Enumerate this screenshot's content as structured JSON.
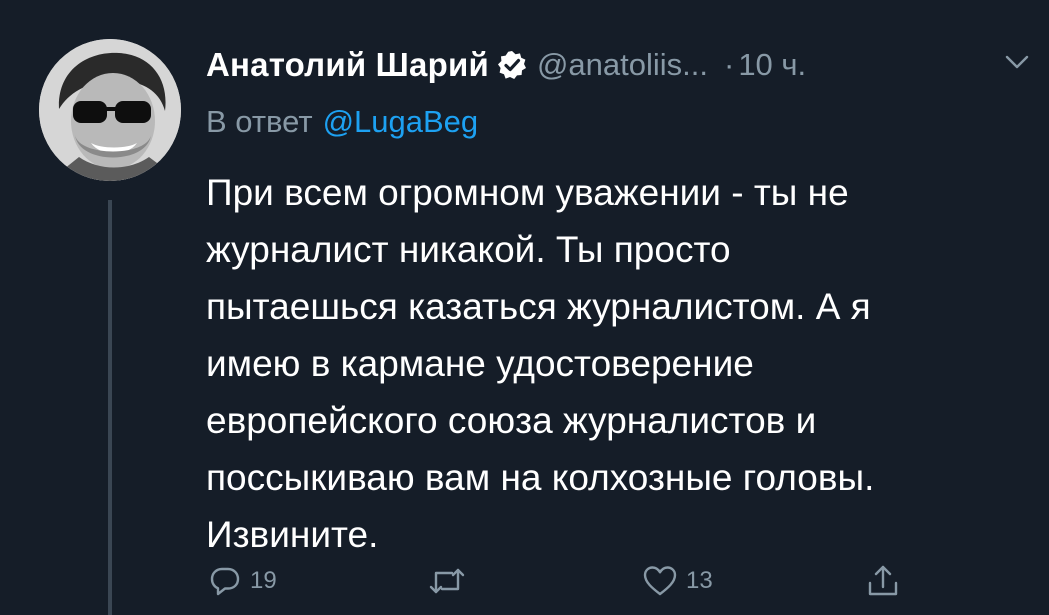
{
  "tweet": {
    "author_name": "Анатолий Шарий",
    "handle": "@anatoliis...",
    "separator": "·",
    "time": "10 ч.",
    "reply_prefix": "В ответ",
    "reply_mention": "@LugaBeg",
    "text_lines": [
      "При всем огромном уважении - ты не",
      "журналист никакой. Ты просто",
      "пытаешься казаться журналистом. А я",
      "имею в кармане удостоверение",
      "европейского союза журналистов и",
      "поссыкиваю вам на колхозные головы.",
      "Извините."
    ],
    "reply_count": "19",
    "like_count": "13"
  },
  "colors": {
    "background": "#151d28",
    "text": "#ffffff",
    "muted": "#8899a6",
    "link": "#1da1f2",
    "verified": "#ffffff"
  },
  "icons": {
    "verified": "verified-badge-icon",
    "menu": "chevron-down-icon",
    "reply": "reply-icon",
    "retweet": "retweet-icon",
    "like": "heart-icon",
    "share": "share-icon"
  }
}
